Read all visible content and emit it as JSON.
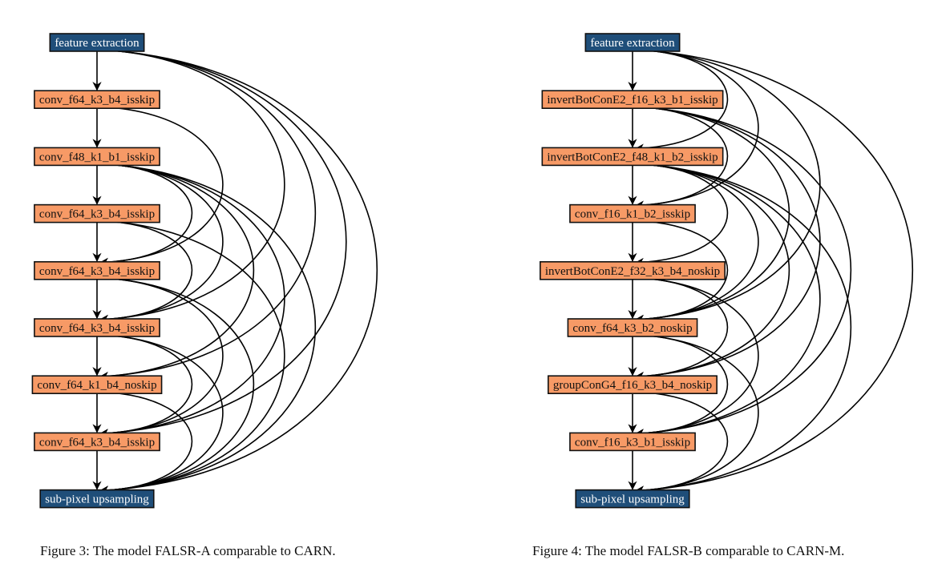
{
  "colors": {
    "io_fill": "#1f4e79",
    "io_text": "#ffffff",
    "cell_fill": "#f79a66",
    "cell_text": "#111111",
    "border": "#111111",
    "edge": "#000000"
  },
  "figures": [
    {
      "id": "falsr-a",
      "caption": "Figure 3: The model FALSR-A comparable to CARN.",
      "nodes": [
        {
          "label": "feature extraction",
          "kind": "io"
        },
        {
          "label": "conv_f64_k3_b4_isskip",
          "kind": "cell"
        },
        {
          "label": "conv_f48_k1_b1_isskip",
          "kind": "cell"
        },
        {
          "label": "conv_f64_k3_b4_isskip",
          "kind": "cell"
        },
        {
          "label": "conv_f64_k3_b4_isskip",
          "kind": "cell"
        },
        {
          "label": "conv_f64_k3_b4_isskip",
          "kind": "cell"
        },
        {
          "label": "conv_f64_k1_b4_noskip",
          "kind": "cell"
        },
        {
          "label": "conv_f64_k3_b4_isskip",
          "kind": "cell"
        },
        {
          "label": "sub-pixel upsampling",
          "kind": "io"
        }
      ],
      "skip_edges": [
        [
          0,
          5
        ],
        [
          0,
          6
        ],
        [
          0,
          7
        ],
        [
          0,
          8
        ],
        [
          1,
          4
        ],
        [
          2,
          4
        ],
        [
          2,
          5
        ],
        [
          2,
          6
        ],
        [
          2,
          7
        ],
        [
          2,
          8
        ],
        [
          3,
          5
        ],
        [
          3,
          8
        ],
        [
          4,
          7
        ],
        [
          4,
          8
        ],
        [
          5,
          7
        ],
        [
          5,
          8
        ],
        [
          6,
          8
        ]
      ]
    },
    {
      "id": "falsr-b",
      "caption": "Figure 4: The model FALSR-B comparable to CARN-M.",
      "nodes": [
        {
          "label": "feature extraction",
          "kind": "io"
        },
        {
          "label": "invertBotConE2_f16_k3_b1_isskip",
          "kind": "cell"
        },
        {
          "label": "invertBotConE2_f48_k1_b2_isskip",
          "kind": "cell"
        },
        {
          "label": "conv_f16_k1_b2_isskip",
          "kind": "cell"
        },
        {
          "label": "invertBotConE2_f32_k3_b4_noskip",
          "kind": "cell"
        },
        {
          "label": "conv_f64_k3_b2_noskip",
          "kind": "cell"
        },
        {
          "label": "groupConG4_f16_k3_b4_noskip",
          "kind": "cell"
        },
        {
          "label": "conv_f16_k3_b1_isskip",
          "kind": "cell"
        },
        {
          "label": "sub-pixel upsampling",
          "kind": "io"
        }
      ],
      "skip_edges": [
        [
          0,
          2
        ],
        [
          0,
          3
        ],
        [
          0,
          5
        ],
        [
          0,
          8
        ],
        [
          1,
          3
        ],
        [
          1,
          5
        ],
        [
          1,
          6
        ],
        [
          1,
          7
        ],
        [
          2,
          4
        ],
        [
          2,
          5
        ],
        [
          2,
          6
        ],
        [
          2,
          7
        ],
        [
          2,
          8
        ],
        [
          3,
          5
        ],
        [
          4,
          6
        ],
        [
          4,
          7
        ],
        [
          5,
          7
        ],
        [
          5,
          8
        ],
        [
          6,
          8
        ]
      ]
    }
  ]
}
